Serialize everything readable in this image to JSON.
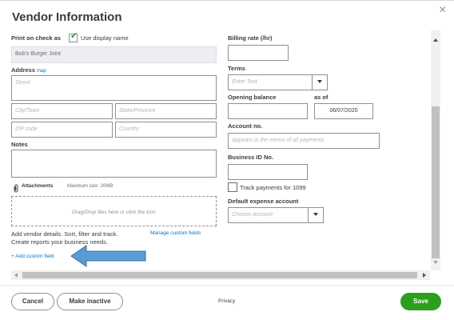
{
  "dialog": {
    "title": "Vendor Information",
    "close_glyph": "×"
  },
  "left": {
    "print_on_check_label": "Print on check as",
    "use_display_name_label": "Use display name",
    "use_display_name_checked": true,
    "print_on_check_value": "Bob's Burger Joint",
    "address_label": "Address",
    "map_link": "map",
    "street_placeholder": "Street",
    "city_placeholder": "City/Town",
    "state_placeholder": "State/Province",
    "zip_placeholder": "ZIP code",
    "country_placeholder": "Country",
    "notes_label": "Notes",
    "attachments_label": "Attachments",
    "max_size_text": "Maximum size: 20MB",
    "drop_text": "Drag/Drop files here or click the icon",
    "custom_desc": "Add vendor details. Sort, filter and track. Create reports your business needs.",
    "manage_custom_fields": "Manage custom fields",
    "add_custom_field": "+ Add custom field"
  },
  "right": {
    "billing_rate_label": "Billing rate (/hr)",
    "terms_label": "Terms",
    "terms_placeholder": "Enter Text",
    "opening_balance_label": "Opening balance",
    "as_of_label": "as of",
    "as_of_value": "06/07/2020",
    "account_no_label": "Account no.",
    "account_no_placeholder": "Appears in the memo of all payments",
    "business_id_label": "Business ID No.",
    "track_1099_label": "Track payments for 1099",
    "track_1099_checked": false,
    "default_expense_label": "Default expense account",
    "default_expense_placeholder": "Choose Account"
  },
  "footer": {
    "cancel": "Cancel",
    "make_inactive": "Make inactive",
    "privacy": "Privacy",
    "save": "Save"
  },
  "colors": {
    "accent_green": "#2ca01c",
    "link_blue": "#0077c5",
    "annotation_arrow": "#5b9bd5"
  },
  "icons": {
    "close": "close-icon",
    "checkmark": "checkmark-icon",
    "paperclip": "paperclip-icon",
    "dropdown": "chevron-down-icon",
    "annotation": "arrow-left-icon"
  }
}
